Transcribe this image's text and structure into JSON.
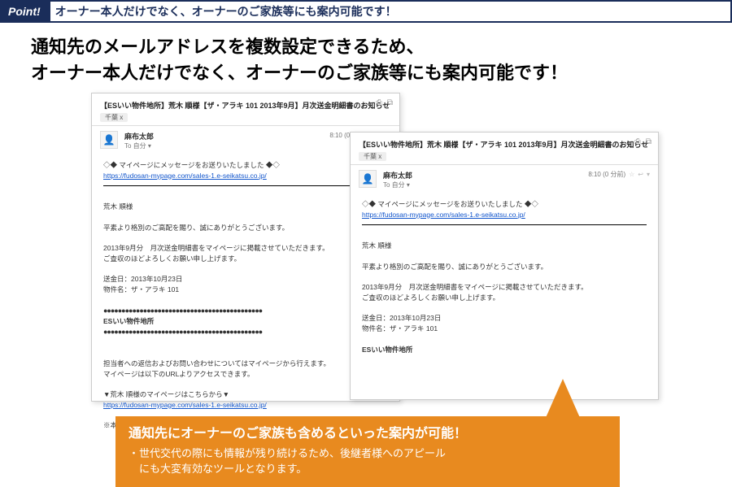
{
  "header": {
    "badge": "Point!",
    "text": "オーナー本人だけでなく、オーナーのご家族等にも案内可能です！"
  },
  "heading_line1": "通知先のメールアドレスを複数設定できるため、",
  "heading_line2": "オーナー本人だけでなく、オーナーのご家族等にも案内可能です！",
  "mail": {
    "subject": "【ESいい物件地所】荒木 順様【ザ・アラキ 101 2013年9月】月次送金明細書のお知らせ",
    "label": "千葉 x",
    "from": "麻布太郎",
    "to": "To 自分",
    "time": "8:10 (0 分前)",
    "body": {
      "msg_notice": "◇◆ マイページにメッセージをお送りいたしました ◆◇",
      "link1": "https://fudosan-mypage.com/sales-1.e-seikatsu.co.jp/",
      "greeting_name": "荒木 順様",
      "greeting_text": "平素より格別のご高配を賜り、誠にありがとうございます。",
      "body_text1": "2013年9月分　月次送金明細書をマイページに掲載させていただきます。",
      "body_text2": "ご査収のほどよろしくお願い申し上げます。",
      "send_date": "送金日：2013年10月23日",
      "property": "物件名：ザ・アラキ 101",
      "company": "ESいい物件地所",
      "note1": "担当者への返信およびお問い合わせについてはマイページから行えます。",
      "note2": "マイページは以下のURLよりアクセスできます。",
      "mypage_label": "▼荒木 順様のマイページはこちらから▼",
      "link2": "https://fudosan-mypage.com/sales-1.e-seikatsu.co.jp/",
      "footer_note": "※本メールにお心当たりがない場合はお手数ですが以下の連絡先まで"
    }
  },
  "callout": {
    "title": "通知先にオーナーのご家族も含めるといった案内が可能！",
    "line1": "・世代交代の際にも情報が残り続けるため、後継者様へのアピール",
    "line2": "　にも大変有効なツールとなります。"
  },
  "dots": "●●●●●●●●●●●●●●●●●●●●●●●●●●●●●●●●●●●●●●●●●●●●"
}
